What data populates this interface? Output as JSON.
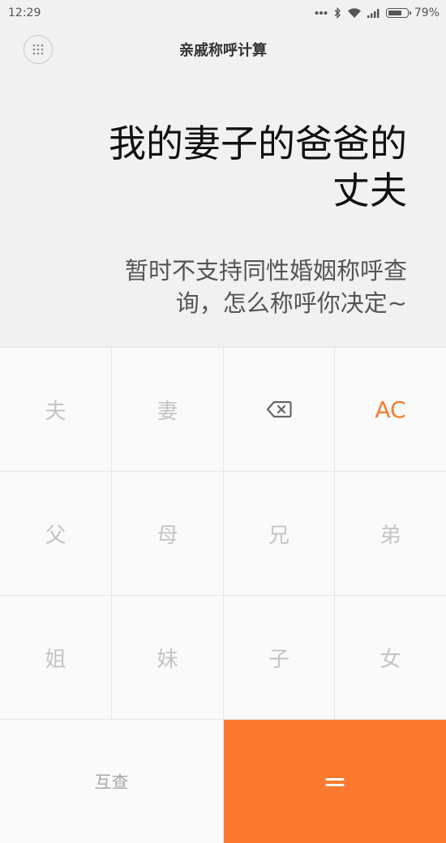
{
  "status_bar": {
    "time": "12:29",
    "battery_percent": "79%",
    "battery_level": 0.79,
    "icons": [
      "more-dots-icon",
      "bluetooth-icon",
      "wifi-icon",
      "signal-icon",
      "battery-icon"
    ]
  },
  "header": {
    "title": "亲戚称呼计算",
    "menu_icon": "grid-menu-icon"
  },
  "display": {
    "result_line1": "我的妻子的爸爸的",
    "result_line2": "丈夫",
    "note_line1": "暂时不支持同性婚姻称呼查",
    "note_line2": "询，怎么称呼你决定~"
  },
  "keypad": {
    "husband": "夫",
    "wife": "妻",
    "backspace_icon": "backspace-icon",
    "clear": "AC",
    "father": "父",
    "mother": "母",
    "elder_brother": "兄",
    "younger_brother": "弟",
    "elder_sister": "姐",
    "younger_sister": "妹",
    "son": "子",
    "daughter": "女",
    "swap": "互查",
    "equals": "="
  },
  "colors": {
    "accent": "#fb7a2f",
    "ac_text": "#f77b2d",
    "key_text_disabled": "#c4c4c4"
  }
}
